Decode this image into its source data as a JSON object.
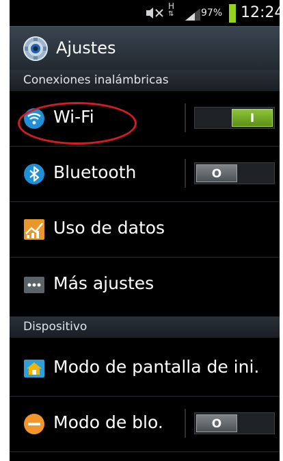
{
  "status_bar": {
    "network_type": "H",
    "battery": "97%",
    "time": "12:24"
  },
  "title_bar": {
    "title": "Ajustes"
  },
  "sections": {
    "wireless": "Conexiones inalámbricas",
    "device": "Dispositivo"
  },
  "rows": {
    "wifi": {
      "label": "Wi-Fi",
      "toggle": "I",
      "enabled": true
    },
    "bluetooth": {
      "label": "Bluetooth",
      "toggle": "O",
      "enabled": false
    },
    "data_usage": {
      "label": "Uso de datos"
    },
    "more": {
      "label": "Más ajustes"
    },
    "home_screen": {
      "label": "Modo de pantalla de ini."
    },
    "block_mode": {
      "label": "Modo de blo.",
      "toggle": "O",
      "enabled": false
    }
  },
  "colors": {
    "wifi_highlight": "#d81a22",
    "toggle_on": "#7ab52a",
    "battery": "#93d31d"
  }
}
